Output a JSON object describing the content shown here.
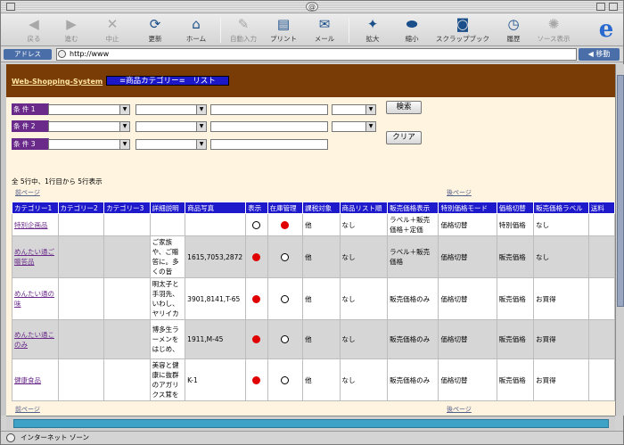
{
  "browser": {
    "toolbar": [
      {
        "label": "戻る",
        "icon": "back-arrow-icon",
        "enabled": false
      },
      {
        "label": "進む",
        "icon": "forward-arrow-icon",
        "enabled": false
      },
      {
        "label": "中止",
        "icon": "stop-icon",
        "enabled": false
      },
      {
        "label": "更新",
        "icon": "refresh-icon",
        "enabled": true
      },
      {
        "label": "ホーム",
        "icon": "home-icon",
        "enabled": true
      },
      {
        "label": "自動入力",
        "icon": "autofill-icon",
        "enabled": false
      },
      {
        "label": "プリント",
        "icon": "print-icon",
        "enabled": true
      },
      {
        "label": "メール",
        "icon": "mail-icon",
        "enabled": true
      },
      {
        "label": "拡大",
        "icon": "zoom-in-icon",
        "enabled": true
      },
      {
        "label": "縮小",
        "icon": "zoom-out-icon",
        "enabled": true
      },
      {
        "label": "スクラップブック",
        "icon": "camera-icon",
        "enabled": true
      },
      {
        "label": "履歴",
        "icon": "history-icon",
        "enabled": true
      },
      {
        "label": "ソース表示",
        "icon": "source-icon",
        "enabled": false
      }
    ],
    "address_label": "アドレス",
    "url": "http://www",
    "go_label": "移動",
    "status": "インターネット ゾーン"
  },
  "page": {
    "site_link": "Web-Shopping-System",
    "title": "=商品カテゴリー=　リスト",
    "conditions": [
      "条 件 1",
      "条 件 2",
      "条 件 3"
    ],
    "search_button": "検索",
    "clear_button": "クリア",
    "summary": "全 5行中、1行目から 5行表示",
    "prev_page": "前ページ",
    "next_page": "後ページ"
  },
  "table": {
    "columns": [
      "カテゴリー1",
      "カテゴリー2",
      "カテゴリー3",
      "詳細説明",
      "商品写真",
      "表示",
      "在庫管理",
      "課税対象",
      "商品リスト順",
      "販売価格表示",
      "特別価格モード",
      "価格切替",
      "販売価格ラベル",
      "送料"
    ],
    "rows": [
      {
        "cat1": "特別企画品",
        "cat2": "",
        "cat3": "",
        "detail": "",
        "photo": "",
        "display": false,
        "stock": true,
        "tax": "他",
        "order": "なし",
        "price_display": "ラベル＋販売価格＋定価",
        "special_mode": "価格切替",
        "price_switch": "特別価格",
        "price_label": "なし"
      },
      {
        "cat1": "めんたい通ご贈答品",
        "cat2": "",
        "cat3": "",
        "detail": "ご家族や、ご贈答に。多くの皆",
        "photo": "1615,7053,2872",
        "display": true,
        "stock": false,
        "tax": "他",
        "order": "なし",
        "price_display": "ラベル＋販売価格",
        "special_mode": "価格切替",
        "price_switch": "販売価格",
        "price_label": "なし"
      },
      {
        "cat1": "めんたい通の味",
        "cat2": "",
        "cat3": "",
        "detail": "明太子と手羽先、いわし、ヤリイカ",
        "photo": "3901,8141,T-65",
        "display": true,
        "stock": false,
        "tax": "他",
        "order": "なし",
        "price_display": "販売価格のみ",
        "special_mode": "価格切替",
        "price_switch": "販売価格",
        "price_label": "お買得"
      },
      {
        "cat1": "めんたい通このみ",
        "cat2": "",
        "cat3": "",
        "detail": "博多生ラーメンをはじめ、",
        "photo": "1911,M-45",
        "display": true,
        "stock": false,
        "tax": "他",
        "order": "なし",
        "price_display": "販売価格のみ",
        "special_mode": "価格切替",
        "price_switch": "販売価格",
        "price_label": "お買得"
      },
      {
        "cat1": "健康食品",
        "cat2": "",
        "cat3": "",
        "detail": "美容と健康に抜群のアガリクス茸を",
        "photo": "K-1",
        "display": true,
        "stock": false,
        "tax": "他",
        "order": "なし",
        "price_display": "販売価格のみ",
        "special_mode": "価格切替",
        "price_switch": "販売価格",
        "price_label": "お買得"
      }
    ]
  },
  "colors": {
    "header_band": "#7a3c06",
    "table_header": "#1e1acc",
    "link": "#6a2a8a",
    "red_dot": "#e00000"
  }
}
